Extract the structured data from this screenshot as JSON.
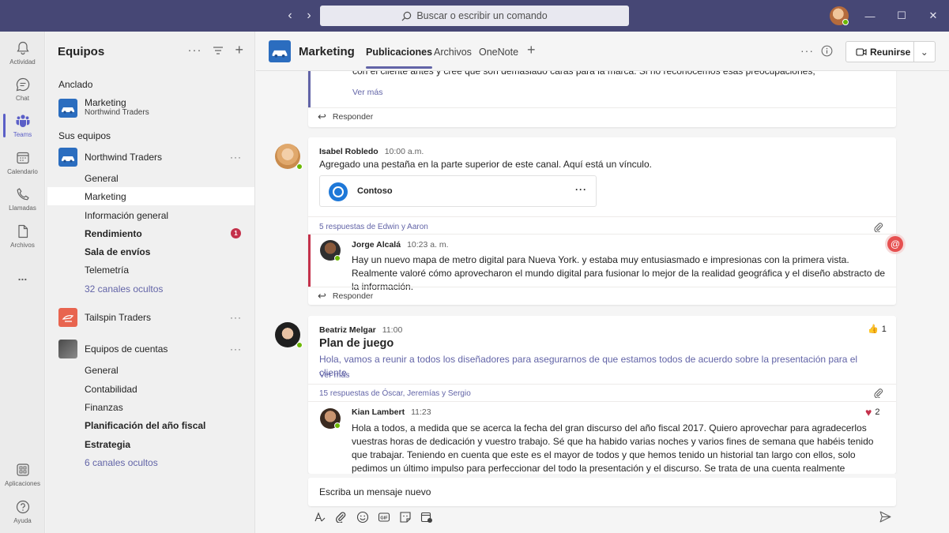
{
  "titlebar": {
    "search_placeholder": "Buscar o escribir un comando"
  },
  "rail": {
    "items": [
      {
        "label": "Actividad",
        "icon": "bell-icon"
      },
      {
        "label": "Chat",
        "icon": "chat-icon"
      },
      {
        "label": "Teams",
        "icon": "teams-icon"
      },
      {
        "label": "Calendario",
        "icon": "calendar-icon"
      },
      {
        "label": "Llamadas",
        "icon": "phone-icon"
      },
      {
        "label": "Archivos",
        "icon": "file-icon"
      },
      {
        "label": "...",
        "icon": "more-icon"
      }
    ],
    "bottom": [
      {
        "label": "Aplicaciones",
        "icon": "apps-icon"
      },
      {
        "label": "Ayuda",
        "icon": "help-icon"
      }
    ]
  },
  "teams_panel": {
    "title": "Equipos",
    "pinned_label": "Anclado",
    "pinned": {
      "name": "Marketing",
      "subtitle": "Northwind Traders"
    },
    "your_teams_label": "Sus equipos",
    "teams": [
      {
        "name": "Northwind Traders",
        "channels": [
          {
            "name": "General"
          },
          {
            "name": "Marketing"
          },
          {
            "name": "Información general"
          },
          {
            "name": "Rendimiento",
            "badge": "1"
          },
          {
            "name": "Sala de envíos"
          },
          {
            "name": "Telemetría"
          },
          {
            "name": "32 canales ocultos"
          }
        ]
      },
      {
        "name": "Tailspin Traders",
        "channels": []
      },
      {
        "name": "Equipos de cuentas",
        "channels": [
          {
            "name": "General"
          },
          {
            "name": "Contabilidad"
          },
          {
            "name": "Finanzas"
          },
          {
            "name": "Planificación del año fiscal"
          },
          {
            "name": "Estrategia"
          },
          {
            "name": "6 canales ocultos"
          }
        ]
      }
    ]
  },
  "channel": {
    "title": "Marketing",
    "tabs": [
      "Publicaciones",
      "Archivos",
      "OneNote"
    ],
    "meet_label": "Reunirse"
  },
  "feed": {
    "post0": {
      "text": "con el cliente antes y cree que son demasiado caras para la marca. Si no reconocemos esas preocupaciones,",
      "see_more": "Ver más",
      "reply": "Responder"
    },
    "post1": {
      "author": "Isabel Robledo",
      "time": "10:00 a.m.",
      "text": "Agregado una pestaña en la parte superior de este canal. Aquí está un vínculo.",
      "card_title": "Contoso",
      "replies_summary": "5 respuestas de Edwin y Aaron",
      "reply_author": "Jorge Alcalá",
      "reply_time": "10:23 a. m.",
      "reply_text": "Hay un nuevo mapa de metro digital para Nueva York. y estaba muy entusiasmado e impresionas con la primera vista. Realmente valoré cómo aprovecharon el mundo digital para fusionar lo mejor de la realidad geográfica y el diseño abstracto de la información.",
      "reply": "Responder"
    },
    "post2": {
      "author": "Beatriz Melgar",
      "time": "11:00",
      "likes": "1",
      "subject": "Plan de juego",
      "text": "Hola, vamos a reunir a todos los diseñadores para asegurarnos de que estamos todos de acuerdo sobre la presentación para el cliente.",
      "see_more": "Ver más",
      "replies_summary": "15 respuestas de Óscar, Jeremías y Sergio",
      "reply_author": "Kian Lambert",
      "reply_time": "11:23",
      "reply_hearts": "2",
      "reply_text": "Hola a todos, a medida que se acerca la fecha del gran discurso del año fiscal 2017. Quiero aprovechar para agradecerlos vuestras horas de dedicación y vuestro trabajo. Sé que ha habido varias noches y varios fines de semana que habéis tenido que trabajar. Teniendo en cuenta que este es el mayor de todos y que hemos tenido un historial tan largo con ellos, solo pedimos un último impulso para perfeccionar del todo la presentación y el discurso. Se trata de una cuenta realmente importante y es muy importante"
    }
  },
  "compose": {
    "placeholder": "Escriba un mensaje nuevo"
  },
  "colors": {
    "titlebar": "#464775",
    "accent": "#6264a7",
    "mention": "#c4314b",
    "presence": "#6bb700"
  }
}
